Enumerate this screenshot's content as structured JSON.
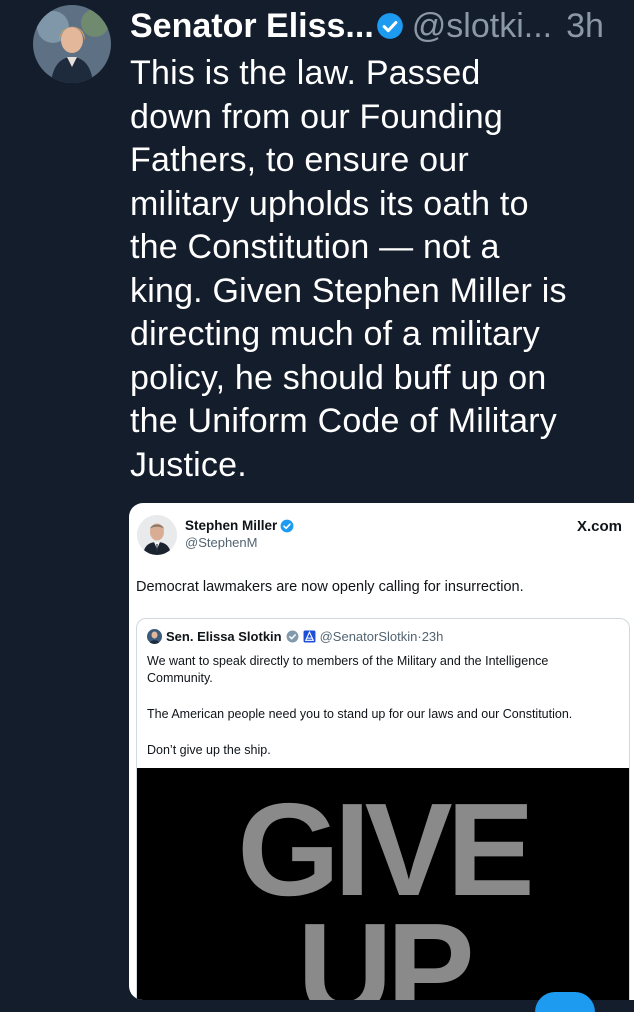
{
  "post": {
    "author_name": "Senator Eliss...",
    "author_handle": "@slotki...",
    "time": "3h",
    "text": "This is the law. Passed\ndown from our Founding\nFathers, to ensure our\nmilitary upholds its oath to\nthe Constitution — not a\nking. Given Stephen Miller is\ndirecting much of a military\npolicy, he should buff up on\nthe Uniform Code of Military\nJustice."
  },
  "quoted": {
    "author_name": "Stephen Miller",
    "author_handle": "@StephenM",
    "source": "X.com",
    "text": "Democrat lawmakers are now openly calling for insurrection.",
    "inner": {
      "author_name": "Sen. Elissa Slotkin",
      "author_handle": "@SenatorSlotkin",
      "time": "23h",
      "paragraphs": [
        "We want to speak directly to members of the Military and the Intelligence Community.",
        "The American people need you to stand up for our laws and our Constitution.",
        "Don’t give up the ship."
      ],
      "media_text": "GIVE\nUP"
    }
  },
  "colors": {
    "background": "#141d2b",
    "verified": "#1d9bf0",
    "muted": "#8b98a5"
  },
  "icons": {
    "verified": "verified-badge-icon",
    "gov": "government-label-icon"
  }
}
